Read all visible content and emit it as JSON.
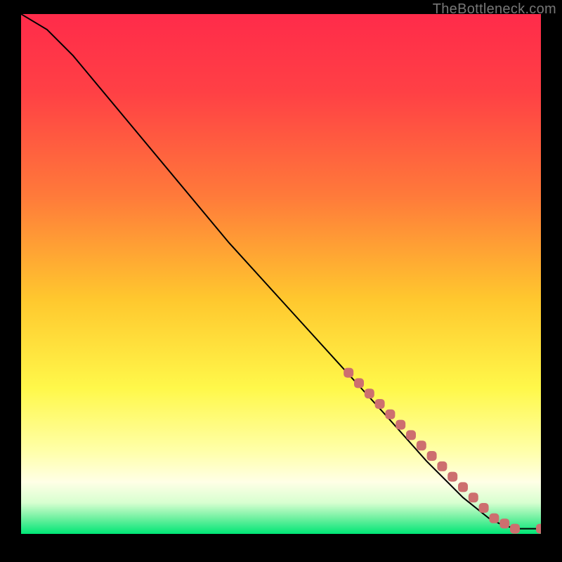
{
  "watermark": "TheBottleneck.com",
  "chart_data": {
    "type": "line",
    "title": "",
    "xlabel": "",
    "ylabel": "",
    "xlim": [
      0,
      100
    ],
    "ylim": [
      0,
      100
    ],
    "background_gradient_stops": [
      {
        "offset": 0.0,
        "color": "#ff2b4a"
      },
      {
        "offset": 0.15,
        "color": "#ff4045"
      },
      {
        "offset": 0.35,
        "color": "#ff7a3a"
      },
      {
        "offset": 0.55,
        "color": "#ffc82e"
      },
      {
        "offset": 0.72,
        "color": "#fff84a"
      },
      {
        "offset": 0.84,
        "color": "#ffffa8"
      },
      {
        "offset": 0.9,
        "color": "#ffffe6"
      },
      {
        "offset": 0.94,
        "color": "#d8ffd0"
      },
      {
        "offset": 0.97,
        "color": "#6ff0a0"
      },
      {
        "offset": 1.0,
        "color": "#00e676"
      }
    ],
    "series": [
      {
        "name": "curve",
        "type": "line",
        "color": "#000000",
        "x": [
          0,
          5,
          10,
          15,
          20,
          30,
          40,
          50,
          60,
          70,
          78,
          85,
          90,
          92,
          95,
          97,
          100
        ],
        "y": [
          100,
          97,
          92,
          86,
          80,
          68,
          56,
          45,
          34,
          23,
          14,
          7,
          3,
          2,
          1,
          1,
          1
        ]
      },
      {
        "name": "markers",
        "type": "scatter",
        "color": "#cd6f6f",
        "marker_radius": 7,
        "x": [
          63,
          65,
          67,
          69,
          71,
          73,
          75,
          77,
          79,
          81,
          83,
          85,
          87,
          89,
          91,
          93,
          95,
          100
        ],
        "y": [
          31,
          29,
          27,
          25,
          23,
          21,
          19,
          17,
          15,
          13,
          11,
          9,
          7,
          5,
          3,
          2,
          1,
          1
        ]
      }
    ]
  }
}
